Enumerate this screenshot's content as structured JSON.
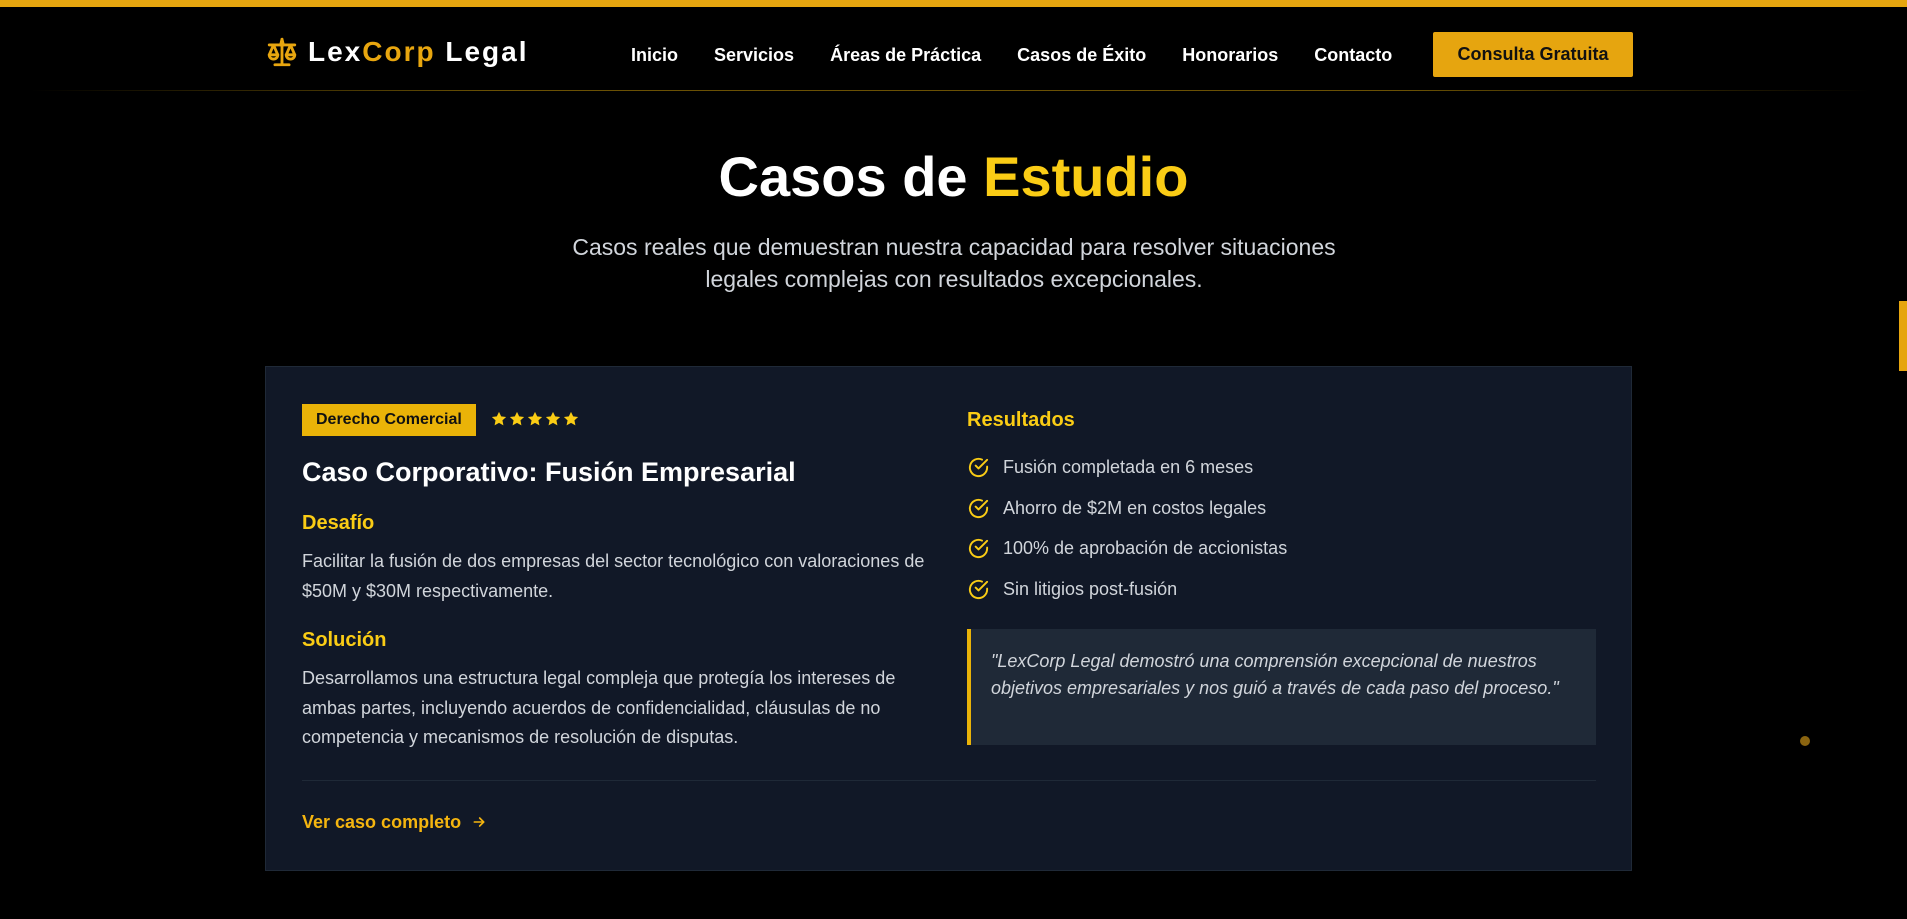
{
  "colors": {
    "accent": "#eab308",
    "accent_orange": "#e6a50f",
    "background": "#000000",
    "card_background": "#111827",
    "quote_background": "#1f2937",
    "text_muted": "#d1d5db"
  },
  "header": {
    "logo_icon": "scales-of-justice-icon",
    "logo_part1": "Lex",
    "logo_part2": "Corp",
    "logo_part3": " Legal",
    "nav": [
      {
        "label": "Inicio"
      },
      {
        "label": "Servicios"
      },
      {
        "label": "Áreas de Práctica"
      },
      {
        "label": "Casos de Éxito"
      },
      {
        "label": "Honorarios"
      },
      {
        "label": "Contacto"
      }
    ],
    "cta_label": "Consulta Gratuita"
  },
  "hero": {
    "title_part1": "Casos de ",
    "title_part2": "Estudio",
    "subtitle": "Casos reales que demuestran nuestra capacidad para resolver situaciones legales complejas con resultados excepcionales."
  },
  "case": {
    "category_badge": "Derecho Comercial",
    "rating": 5,
    "rating_icon": "star-icon",
    "title": "Caso Corporativo: Fusión Empresarial",
    "challenge_heading": "Desafío",
    "challenge_text": "Facilitar la fusión de dos empresas del sector tecnológico con valoraciones de $50M y $30M respectivamente.",
    "solution_heading": "Solución",
    "solution_text": "Desarrollamos una estructura legal compleja que protegía los intereses de ambas partes, incluyendo acuerdos de confidencialidad, cláusulas de no competencia y mecanismos de resolución de disputas.",
    "results_heading": "Resultados",
    "result_icon": "check-circle-icon",
    "results": [
      "Fusión completada en 6 meses",
      "Ahorro de $2M en costos legales",
      "100% de aprobación de accionistas",
      "Sin litigios post-fusión"
    ],
    "testimonial": "\"LexCorp Legal demostró una comprensión excepcional de nuestros objetivos empresariales y nos guió a través de cada paso del proceso.\"",
    "link_label": "Ver caso completo",
    "link_icon": "arrow-right-icon"
  }
}
